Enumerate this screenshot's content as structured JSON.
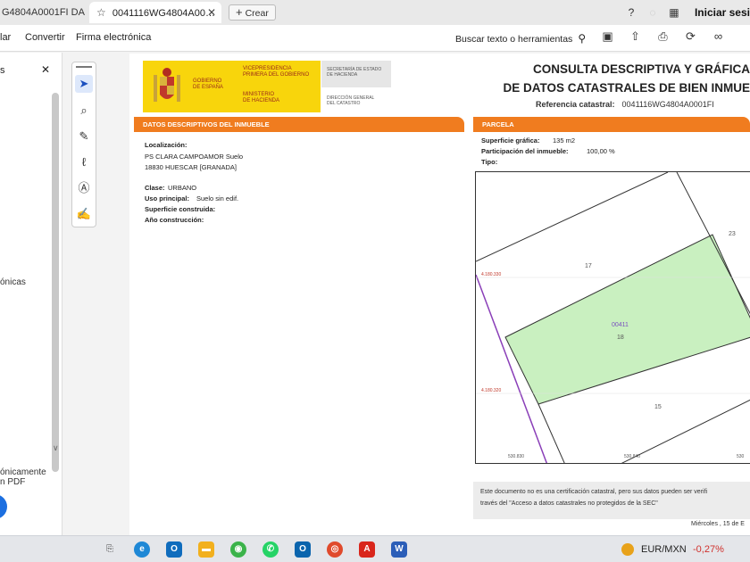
{
  "browser": {
    "tab1_title": "G4804A0001FI DA…",
    "tab2_title": "0041116WG4804A00…",
    "new_tab_label": "Crear",
    "signin_label": "Iniciar sesi"
  },
  "toolbar": {
    "menu": [
      "lar",
      "Convertir",
      "Firma electrónica"
    ],
    "search_label": "Buscar texto o herramientas"
  },
  "sidepanel": {
    "letter": "s",
    "item_text": "ónicas",
    "bottom_line1": "ónicamente",
    "bottom_line2": "n PDF"
  },
  "document": {
    "logo": {
      "gobierno": "GOBIERNO\nDE ESPAÑA",
      "vice": "VICEPRESIDENCIA\nPRIMERA DEL GOBIERNO",
      "ministerio": "MINISTERIO\nDE HACIENDA",
      "sec_estado": "SECRETARÍA DE ESTADO\nDE HACIENDA",
      "dir_catastro": "DIRECCIÓN GENERAL\nDEL CATASTRO"
    },
    "title_line1": "CONSULTA DESCRIPTIVA Y GRÁFICA",
    "title_line2": "DE DATOS CATASTRALES DE BIEN INMUE",
    "ref_label": "Referencia catastral:",
    "ref_value": "0041116WG4804A0001FI",
    "section_left": "DATOS DESCRIPTIVOS DEL INMUEBLE",
    "section_right": "PARCELA",
    "localizacion_label": "Localización:",
    "localizacion_line1": "PS CLARA CAMPOAMOR  Suelo",
    "localizacion_line2": "18830 HUESCAR [GRANADA]",
    "clase_label": "Clase:",
    "clase_value": "URBANO",
    "uso_label": "Uso principal:",
    "uso_value": "Suelo sin edif.",
    "superficie_construida_label": "Superficie construida:",
    "anio_label": "Año construcción:",
    "superficie_grafica_label": "Superficie gráfica:",
    "superficie_grafica_value": "135 m2",
    "participacion_label": "Participación del inmueble:",
    "participacion_value": "100,00 %",
    "tipo_label": "Tipo:",
    "map_labels": {
      "parcel_17": "17",
      "parcel_23": "23",
      "parcel_18": "18",
      "parcel_15": "15",
      "parcel_code": "00411",
      "coord_1": "4.180.330",
      "coord_2": "4.180.320",
      "coord_3": "530.830",
      "coord_4": "530.840",
      "coord_5": "530"
    },
    "disclaimer_line1": "Este documento no es una certificación catastral, pero sus datos pueden ser verifi",
    "disclaimer_line2": "través del \"Acceso a datos catastrales no protegidos de la SEC\"",
    "date_text": "Miércoles , 15 de E"
  },
  "taskbar": {
    "ticker_pair": "EUR/MXN",
    "ticker_change": "-0,27%"
  },
  "colors": {
    "section_orange": "#f07c1f",
    "logo_yellow": "#f8d50c",
    "parcel_green": "#c9f0c0",
    "accent_blue": "#1c6fe0"
  }
}
